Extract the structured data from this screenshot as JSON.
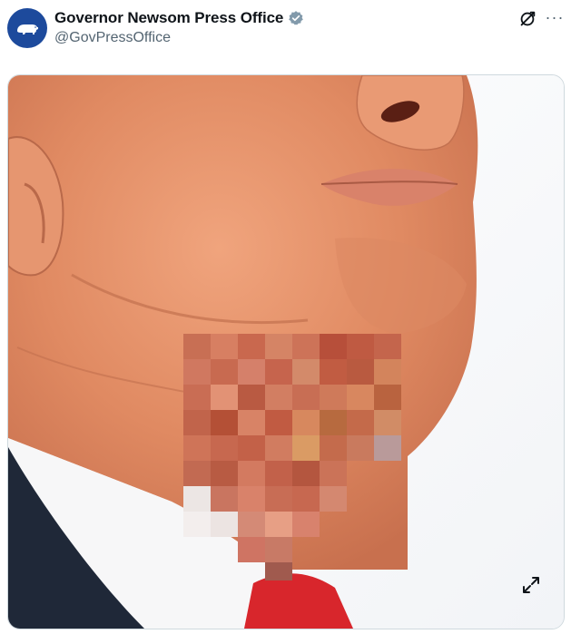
{
  "post": {
    "author_name": "Governor Newsom Press Office",
    "author_handle": "@GovPressOffice",
    "verified": true
  },
  "icons": {
    "avatar": "california-bear-logo",
    "verified": "verified-badge-icon",
    "grok": "grok-icon",
    "more": "more-options-icon",
    "expand": "expand-icon"
  },
  "colors": {
    "avatar_bg": "#1d4a9c",
    "verified": "#829aab",
    "handle": "#536471",
    "skin": "#e0926a",
    "suit": "#1f2838",
    "tie": "#d8262c"
  },
  "image": {
    "subject": "close-up of a chin and neck against a white background with a pixelated censor block",
    "censored": true
  }
}
